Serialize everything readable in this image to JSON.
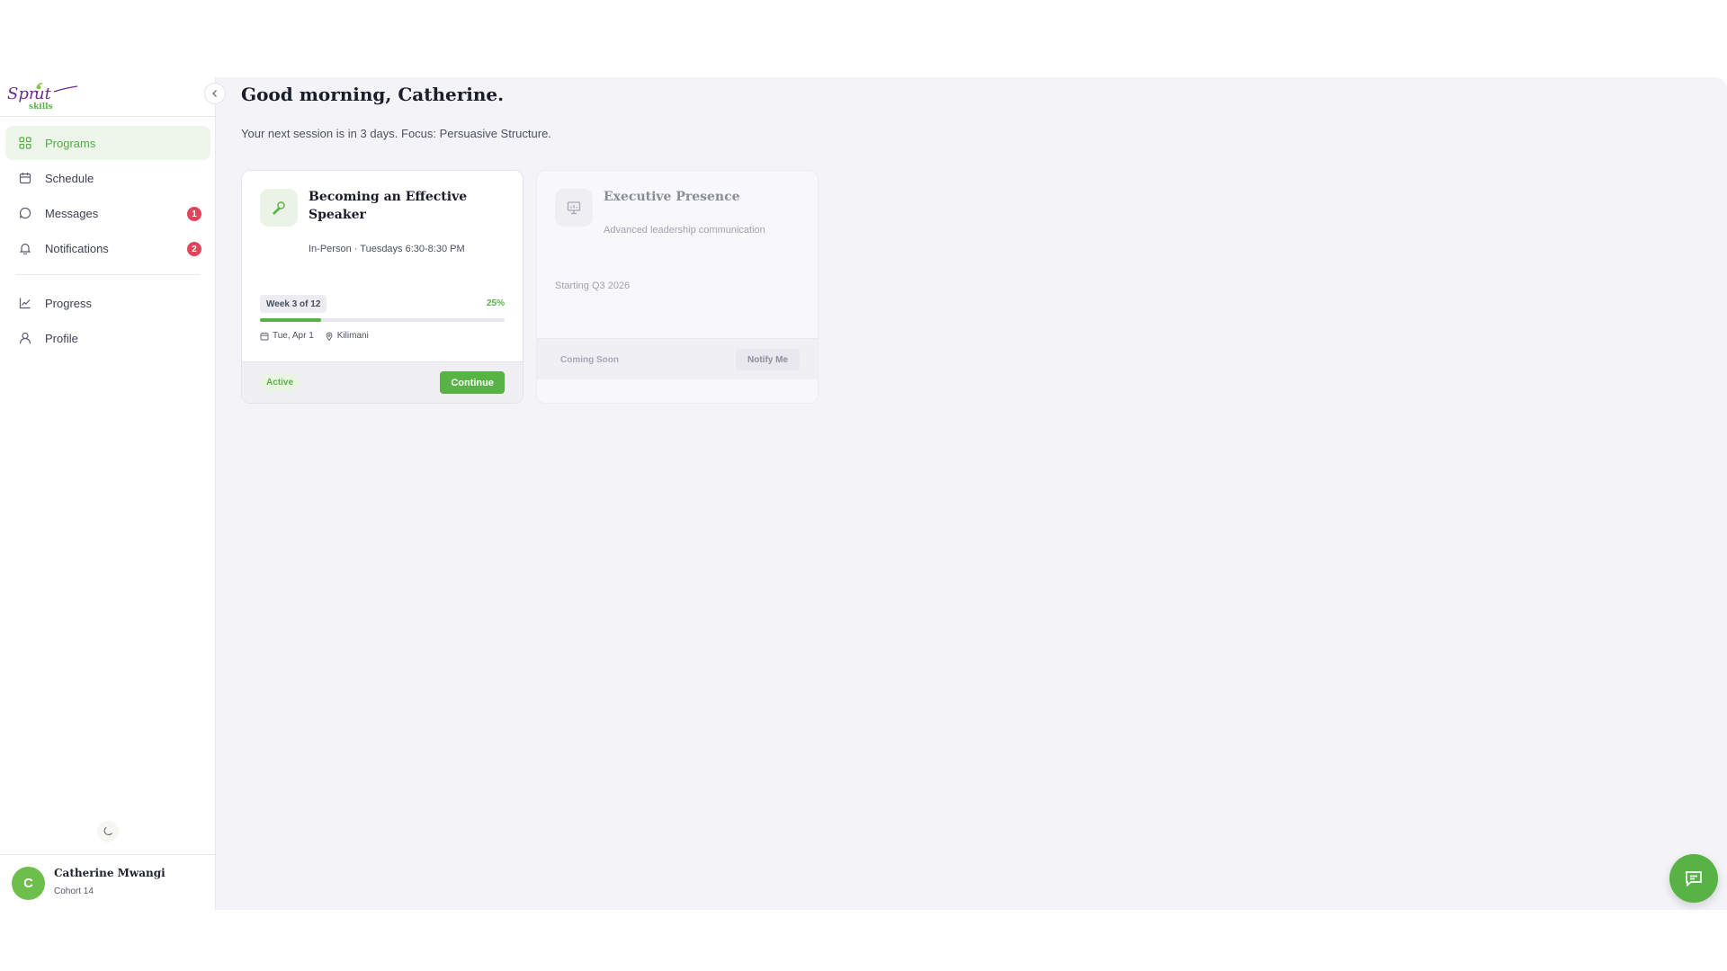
{
  "brand": {
    "logo_text": "Sprout",
    "logo_sub": "skills",
    "accent": "#59b245",
    "logo_purple": "#6b2d8e"
  },
  "sidebar": {
    "items": [
      {
        "label": "Programs",
        "icon": "grid-icon",
        "active": true
      },
      {
        "label": "Schedule",
        "icon": "calendar-icon"
      },
      {
        "label": "Messages",
        "icon": "chat-bubble-icon",
        "badge": "1"
      },
      {
        "label": "Notifications",
        "icon": "bell-icon",
        "badge": "2"
      },
      {
        "label": "Progress",
        "icon": "trend-chart-icon"
      },
      {
        "label": "Profile",
        "icon": "user-icon"
      }
    ],
    "theme_icon": "moon-icon",
    "user": {
      "initial": "C",
      "name": "Catherine Mwangi",
      "cohort": "Cohort 14"
    }
  },
  "main": {
    "greeting": "Good morning, Catherine.",
    "subtext": "Your next session is in 3 days. Focus: Persuasive Structure.",
    "cards": [
      {
        "icon": "microphone-icon",
        "title": "Becoming an Effective Speaker",
        "meta": "In-Person · Tuesdays 6:30-8:30 PM",
        "week": "Week 3 of 12",
        "progress_pct": "25%",
        "progress_fraction": 0.25,
        "date": "Tue, Apr 1",
        "location": "Kilimani",
        "status": "Active",
        "action": "Continue"
      },
      {
        "icon": "presentation-icon",
        "title": "Executive Presence",
        "meta": "Advanced leadership communication",
        "starting": "Starting Q3 2026",
        "status": "Coming Soon",
        "action": "Notify Me"
      }
    ]
  },
  "chat_fab": {
    "icon": "chat-icon"
  }
}
